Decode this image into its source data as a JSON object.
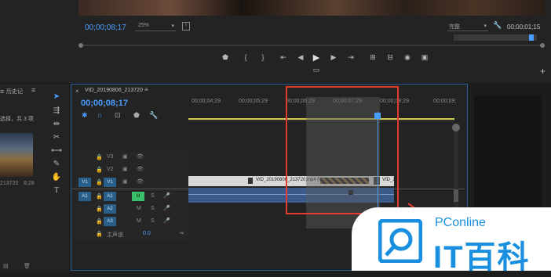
{
  "monitor": {
    "timecode_current": "00;00;08;17",
    "zoom": "25%",
    "quality": "完整",
    "timecode_duration": "00;00;01;15"
  },
  "project": {
    "history_tab": "历史记",
    "selection_text": "选择，共 3 项",
    "clip_duration": "8;28",
    "clip_name_partial": "213720"
  },
  "timeline": {
    "sequence_name": "VID_20190806_213720",
    "timecode": "00;00;08;17",
    "ruler_labels": [
      "00;00;04;29",
      "00;00;05;29",
      "00;00;06;29",
      "00;00;07;29",
      "00;00;08;29",
      "00;00;09;"
    ],
    "tracks": {
      "v3": "V3",
      "v2": "V2",
      "v1": "V1",
      "a1": "A1",
      "a2": "A2",
      "a3": "A3",
      "master": "主声道",
      "master_level": "0.0"
    },
    "source_v": "V1",
    "source_a": "A1",
    "clip_label": "VID_20190806_213720.mp4 [V]",
    "clip_label_right": "VID_2"
  },
  "watermark": {
    "brand_top": "PConline",
    "brand_bottom": "IT百科"
  }
}
